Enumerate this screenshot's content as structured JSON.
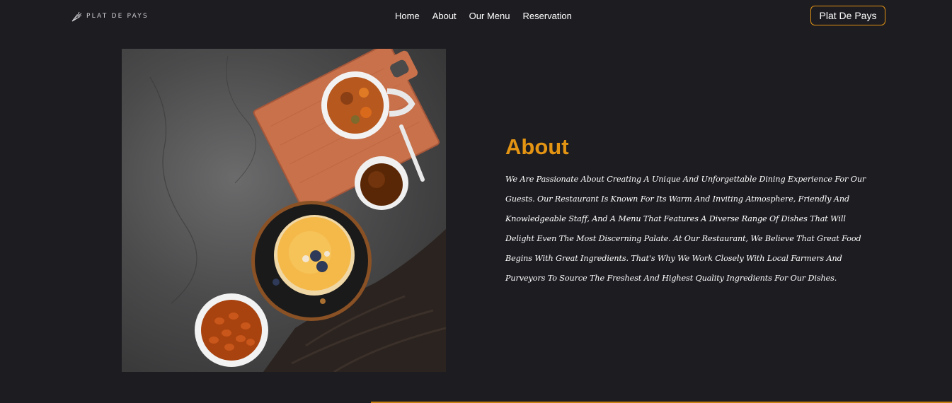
{
  "nav": {
    "logo_text": "PLAT DE PAYS",
    "links": [
      "Home",
      "About",
      "Our Menu",
      "Reservation"
    ],
    "cta_label": "Plat De Pays"
  },
  "about": {
    "title": "About",
    "body": "We Are Passionate About Creating A Unique And Unforgettable Dining Experience For Our Guests. Our Restaurant Is Known For Its Warm And Inviting Atmosphere, Friendly And Knowledgeable Staff, And A Menu That Features A Diverse Range Of Dishes That Will Delight Even The Most Discerning Palate. At Our Restaurant, We Believe That Great Food Begins With Great Ingredients. That's Why We Work Closely With Local Farmers And Purveyors To Source The Freshest And Highest Quality Ingredients For Our Dishes."
  },
  "colors": {
    "background": "#1d1c21",
    "accent": "#e39413",
    "text": "#ffffff"
  },
  "icons": {
    "logo": "carrot-logo-icon"
  }
}
